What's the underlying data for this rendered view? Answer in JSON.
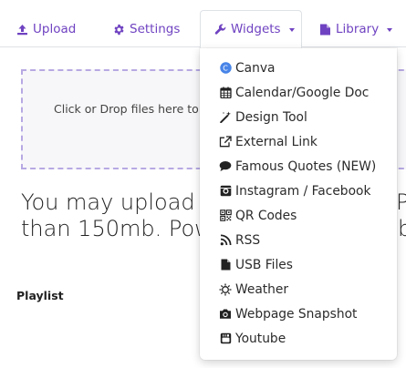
{
  "tabs": {
    "upload": "Upload",
    "settings": "Settings",
    "widgets": "Widgets",
    "library": "Library"
  },
  "dropzone": {
    "text": "Click or Drop files here to"
  },
  "info": {
    "line1": "You may upload p",
    "line1_end": "P",
    "line2": "than 150mb. Pow",
    "line2_end": "b"
  },
  "playlist": {
    "label": "Playlist"
  },
  "widgets_menu": {
    "items": [
      {
        "label": "Canva",
        "icon": "canva-icon"
      },
      {
        "label": "Calendar/Google Doc",
        "icon": "calendar-icon"
      },
      {
        "label": "Design Tool",
        "icon": "magic-wand-icon"
      },
      {
        "label": "External Link",
        "icon": "external-link-icon"
      },
      {
        "label": "Famous Quotes (NEW)",
        "icon": "comment-icon"
      },
      {
        "label": "Instagram / Facebook",
        "icon": "instagram-icon"
      },
      {
        "label": "QR Codes",
        "icon": "qr-code-icon"
      },
      {
        "label": "RSS",
        "icon": "rss-icon"
      },
      {
        "label": "USB Files",
        "icon": "file-icon"
      },
      {
        "label": "Weather",
        "icon": "sun-icon"
      },
      {
        "label": "Webpage Snapshot",
        "icon": "camera-icon"
      },
      {
        "label": "Youtube",
        "icon": "youtube-icon"
      }
    ]
  },
  "colors": {
    "accent": "#6f42c1",
    "canva": "#2bb4e8",
    "dashed_border": "#b7a9e3"
  }
}
